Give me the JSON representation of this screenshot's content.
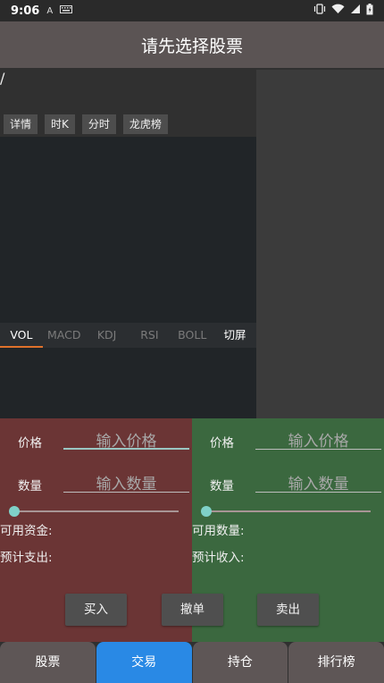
{
  "statusbar": {
    "time": "9:06",
    "icons_left": [
      "A",
      "keyboard"
    ],
    "icons_right": [
      "vibrate-icon",
      "wifi-icon",
      "signal-icon",
      "battery-icon"
    ]
  },
  "appbar": {
    "title": "请先选择股票"
  },
  "stock": {
    "name_line": "/"
  },
  "chart_tabs": [
    "详情",
    "时K",
    "分时",
    "龙虎榜"
  ],
  "indicator_tabs": [
    "VOL",
    "MACD",
    "KDJ",
    "RSI",
    "BOLL",
    "切屏"
  ],
  "buy": {
    "price_label": "价格",
    "price_placeholder": "输入价格",
    "qty_label": "数量",
    "qty_placeholder": "输入数量",
    "avail_label": "可用资金:",
    "expected_label": "预计支出:"
  },
  "sell": {
    "price_label": "价格",
    "price_placeholder": "输入价格",
    "qty_label": "数量",
    "qty_placeholder": "输入数量",
    "avail_label": "可用数量:",
    "expected_label": "预计收入:"
  },
  "actions": {
    "buy": "买入",
    "cancel": "撤单",
    "sell": "卖出"
  },
  "nav": [
    "股票",
    "交易",
    "持仓",
    "排行榜"
  ],
  "colors": {
    "buy_bg": "#6b3535",
    "sell_bg": "#3b683f",
    "nav_active": "#2989e5",
    "tab_underline": "#e0712b"
  }
}
